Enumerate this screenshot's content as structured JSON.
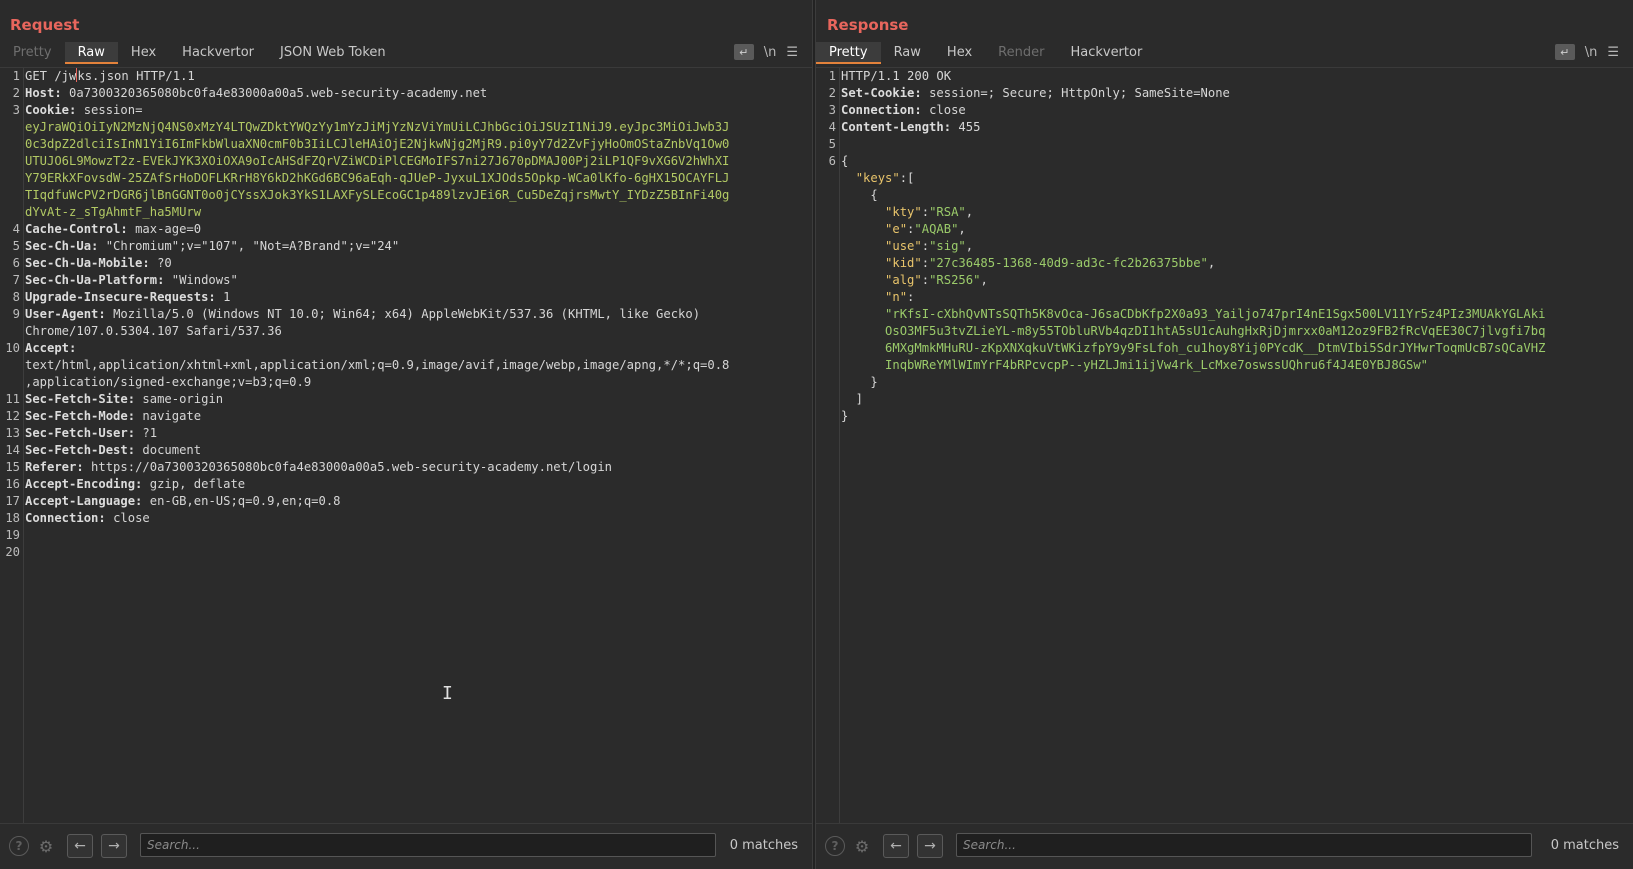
{
  "request": {
    "title": "Request",
    "tabs": [
      {
        "label": "Pretty",
        "state": "disabled"
      },
      {
        "label": "Raw",
        "state": "active"
      },
      {
        "label": "Hex",
        "state": ""
      },
      {
        "label": "Hackvertor",
        "state": ""
      },
      {
        "label": "JSON Web Token",
        "state": ""
      }
    ],
    "newline_toggle": "\\n",
    "lines": [
      {
        "n": "1",
        "parts": [
          {
            "c": "hv",
            "t": "GET /jw"
          },
          {
            "c": "caret",
            "t": ""
          },
          {
            "c": "hv",
            "t": "ks.json HTTP/1.1"
          }
        ]
      },
      {
        "n": "2",
        "parts": [
          {
            "c": "hk",
            "t": "Host: "
          },
          {
            "c": "hv",
            "t": "0a7300320365080bc0fa4e83000a00a5.web-security-academy.net"
          }
        ]
      },
      {
        "n": "3",
        "parts": [
          {
            "c": "hk",
            "t": "Cookie: "
          },
          {
            "c": "hv",
            "t": "session="
          }
        ]
      },
      {
        "n": "",
        "parts": [
          {
            "c": "ck",
            "t": "eyJraWQiOiIyN2MzNjQ4NS0xMzY4LTQwZDktYWQzYy1mYzJiMjYzNzViYmUiLCJhbGciOiJSUzI1NiJ9.eyJpc3MiOiJwb3J"
          }
        ]
      },
      {
        "n": "",
        "parts": [
          {
            "c": "ck",
            "t": "0c3dpZ2dlciIsInN1YiI6ImFkbWluaXN0cmF0b3IiLCJleHAiOjE2NjkwNjg2MjR9.pi0yY7d2ZvFjyHoOmOStaZnbVq1Ow0"
          }
        ]
      },
      {
        "n": "",
        "parts": [
          {
            "c": "ck",
            "t": "UTUJO6L9MowzT2z-EVEkJYK3XOiOXA9oIcAHSdFZQrVZiWCDiPlCEGMoIFS7ni27J670pDMAJ00Pj2iLP1QF9vXG6V2hWhXI"
          }
        ]
      },
      {
        "n": "",
        "parts": [
          {
            "c": "ck",
            "t": "Y79ERkXFovsdW-25ZAfSrHoDOFLKRrH8Y6kD2hKGd6BC96aEqh-qJUeP-JyxuL1XJOds5Opkp-WCa0lKfo-6gHX15OCAYFLJ"
          }
        ]
      },
      {
        "n": "",
        "parts": [
          {
            "c": "ck",
            "t": "TIqdfuWcPV2rDGR6jlBnGGNT0o0jCYssXJok3YkS1LAXFySLEcoGC1p489lzvJEi6R_Cu5DeZqjrsMwtY_IYDzZ5BInFi40g"
          }
        ]
      },
      {
        "n": "",
        "parts": [
          {
            "c": "ck",
            "t": "dYvAt-z_sTgAhmtF_ha5MUrw"
          }
        ]
      },
      {
        "n": "4",
        "parts": [
          {
            "c": "hk",
            "t": "Cache-Control: "
          },
          {
            "c": "hv",
            "t": "max-age=0"
          }
        ]
      },
      {
        "n": "5",
        "parts": [
          {
            "c": "hk",
            "t": "Sec-Ch-Ua: "
          },
          {
            "c": "hv",
            "t": "\"Chromium\";v=\"107\", \"Not=A?Brand\";v=\"24\""
          }
        ]
      },
      {
        "n": "6",
        "parts": [
          {
            "c": "hk",
            "t": "Sec-Ch-Ua-Mobile: "
          },
          {
            "c": "hv",
            "t": "?0"
          }
        ]
      },
      {
        "n": "7",
        "parts": [
          {
            "c": "hk",
            "t": "Sec-Ch-Ua-Platform: "
          },
          {
            "c": "hv",
            "t": "\"Windows\""
          }
        ]
      },
      {
        "n": "8",
        "parts": [
          {
            "c": "hk",
            "t": "Upgrade-Insecure-Requests: "
          },
          {
            "c": "hv",
            "t": "1"
          }
        ]
      },
      {
        "n": "9",
        "parts": [
          {
            "c": "hk",
            "t": "User-Agent: "
          },
          {
            "c": "hv",
            "t": "Mozilla/5.0 (Windows NT 10.0; Win64; x64) AppleWebKit/537.36 (KHTML, like Gecko)"
          }
        ]
      },
      {
        "n": "",
        "parts": [
          {
            "c": "hv",
            "t": "Chrome/107.0.5304.107 Safari/537.36"
          }
        ]
      },
      {
        "n": "10",
        "parts": [
          {
            "c": "hk",
            "t": "Accept: "
          }
        ]
      },
      {
        "n": "",
        "parts": [
          {
            "c": "hv",
            "t": "text/html,application/xhtml+xml,application/xml;q=0.9,image/avif,image/webp,image/apng,*/*;q=0.8"
          }
        ]
      },
      {
        "n": "",
        "parts": [
          {
            "c": "hv",
            "t": ",application/signed-exchange;v=b3;q=0.9"
          }
        ]
      },
      {
        "n": "11",
        "parts": [
          {
            "c": "hk",
            "t": "Sec-Fetch-Site: "
          },
          {
            "c": "hv",
            "t": "same-origin"
          }
        ]
      },
      {
        "n": "12",
        "parts": [
          {
            "c": "hk",
            "t": "Sec-Fetch-Mode: "
          },
          {
            "c": "hv",
            "t": "navigate"
          }
        ]
      },
      {
        "n": "13",
        "parts": [
          {
            "c": "hk",
            "t": "Sec-Fetch-User: "
          },
          {
            "c": "hv",
            "t": "?1"
          }
        ]
      },
      {
        "n": "14",
        "parts": [
          {
            "c": "hk",
            "t": "Sec-Fetch-Dest: "
          },
          {
            "c": "hv",
            "t": "document"
          }
        ]
      },
      {
        "n": "15",
        "parts": [
          {
            "c": "hk",
            "t": "Referer: "
          },
          {
            "c": "hv",
            "t": "https://0a7300320365080bc0fa4e83000a00a5.web-security-academy.net/login"
          }
        ]
      },
      {
        "n": "16",
        "parts": [
          {
            "c": "hk",
            "t": "Accept-Encoding: "
          },
          {
            "c": "hv",
            "t": "gzip, deflate"
          }
        ]
      },
      {
        "n": "17",
        "parts": [
          {
            "c": "hk",
            "t": "Accept-Language: "
          },
          {
            "c": "hv",
            "t": "en-GB,en-US;q=0.9,en;q=0.8"
          }
        ]
      },
      {
        "n": "18",
        "parts": [
          {
            "c": "hk",
            "t": "Connection: "
          },
          {
            "c": "hv",
            "t": "close"
          }
        ]
      },
      {
        "n": "19",
        "parts": []
      },
      {
        "n": "20",
        "parts": []
      }
    ],
    "search_placeholder": "Search...",
    "matches": "0 matches"
  },
  "response": {
    "title": "Response",
    "tabs": [
      {
        "label": "Pretty",
        "state": "active"
      },
      {
        "label": "Raw",
        "state": ""
      },
      {
        "label": "Hex",
        "state": ""
      },
      {
        "label": "Render",
        "state": "disabled"
      },
      {
        "label": "Hackvertor",
        "state": ""
      }
    ],
    "newline_toggle": "\\n",
    "lines": [
      {
        "n": "1",
        "parts": [
          {
            "c": "hv",
            "t": "HTTP/1.1 200 OK"
          }
        ]
      },
      {
        "n": "2",
        "parts": [
          {
            "c": "hk",
            "t": "Set-Cookie: "
          },
          {
            "c": "hv",
            "t": "session=; Secure; HttpOnly; SameSite=None"
          }
        ]
      },
      {
        "n": "3",
        "parts": [
          {
            "c": "hk",
            "t": "Connection: "
          },
          {
            "c": "hv",
            "t": "close"
          }
        ]
      },
      {
        "n": "4",
        "parts": [
          {
            "c": "hk",
            "t": "Content-Length: "
          },
          {
            "c": "hv",
            "t": "455"
          }
        ]
      },
      {
        "n": "5",
        "parts": []
      },
      {
        "n": "6",
        "parts": [
          {
            "c": "jp",
            "t": "{"
          }
        ]
      },
      {
        "n": "",
        "parts": [
          {
            "c": "jp",
            "t": "  "
          },
          {
            "c": "jkey",
            "t": "\"keys\""
          },
          {
            "c": "jp",
            "t": ":["
          }
        ]
      },
      {
        "n": "",
        "parts": [
          {
            "c": "jp",
            "t": "    {"
          }
        ]
      },
      {
        "n": "",
        "parts": [
          {
            "c": "jp",
            "t": "      "
          },
          {
            "c": "jkey",
            "t": "\"kty\""
          },
          {
            "c": "jp",
            "t": ":"
          },
          {
            "c": "jstr",
            "t": "\"RSA\""
          },
          {
            "c": "jp",
            "t": ","
          }
        ]
      },
      {
        "n": "",
        "parts": [
          {
            "c": "jp",
            "t": "      "
          },
          {
            "c": "jkey",
            "t": "\"e\""
          },
          {
            "c": "jp",
            "t": ":"
          },
          {
            "c": "jstr",
            "t": "\"AQAB\""
          },
          {
            "c": "jp",
            "t": ","
          }
        ]
      },
      {
        "n": "",
        "parts": [
          {
            "c": "jp",
            "t": "      "
          },
          {
            "c": "jkey",
            "t": "\"use\""
          },
          {
            "c": "jp",
            "t": ":"
          },
          {
            "c": "jstr",
            "t": "\"sig\""
          },
          {
            "c": "jp",
            "t": ","
          }
        ]
      },
      {
        "n": "",
        "parts": [
          {
            "c": "jp",
            "t": "      "
          },
          {
            "c": "jkey",
            "t": "\"kid\""
          },
          {
            "c": "jp",
            "t": ":"
          },
          {
            "c": "jstr",
            "t": "\"27c36485-1368-40d9-ad3c-fc2b26375bbe\""
          },
          {
            "c": "jp",
            "t": ","
          }
        ]
      },
      {
        "n": "",
        "parts": [
          {
            "c": "jp",
            "t": "      "
          },
          {
            "c": "jkey",
            "t": "\"alg\""
          },
          {
            "c": "jp",
            "t": ":"
          },
          {
            "c": "jstr",
            "t": "\"RS256\""
          },
          {
            "c": "jp",
            "t": ","
          }
        ]
      },
      {
        "n": "",
        "parts": [
          {
            "c": "jp",
            "t": "      "
          },
          {
            "c": "jkey",
            "t": "\"n\""
          },
          {
            "c": "jp",
            "t": ":"
          }
        ]
      },
      {
        "n": "",
        "parts": [
          {
            "c": "jp",
            "t": "      "
          },
          {
            "c": "jstr",
            "t": "\"rKfsI-cXbhQvNTsSQTh5K8vOca-J6saCDbKfp2X0a93_Yailjo747prI4nE1Sgx500LV11Yr5z4PIz3MUAkYGLAki"
          }
        ]
      },
      {
        "n": "",
        "parts": [
          {
            "c": "jp",
            "t": "      "
          },
          {
            "c": "jstr",
            "t": "OsO3MF5u3tvZLieYL-m8y55TObluRVb4qzDI1htA5sU1cAuhgHxRjDjmrxx0aM12oz9FB2fRcVqEE30C7jlvgfi7bq"
          }
        ]
      },
      {
        "n": "",
        "parts": [
          {
            "c": "jp",
            "t": "      "
          },
          {
            "c": "jstr",
            "t": "6MXgMmkMHuRU-zKpXNXqkuVtWKizfpY9y9FsLfoh_cu1hoy8Yij0PYcdK__DtmVIbi5SdrJYHwrToqmUcB7sQCaVHZ"
          }
        ]
      },
      {
        "n": "",
        "parts": [
          {
            "c": "jp",
            "t": "      "
          },
          {
            "c": "jstr",
            "t": "InqbWReYMlWImYrF4bRPcvcpP--yHZLJmi1ijVw4rk_LcMxe7oswssUQhru6f4J4E0YBJ8GSw\""
          }
        ]
      },
      {
        "n": "",
        "parts": [
          {
            "c": "jp",
            "t": "    }"
          }
        ]
      },
      {
        "n": "",
        "parts": [
          {
            "c": "jp",
            "t": "  ]"
          }
        ]
      },
      {
        "n": "",
        "parts": [
          {
            "c": "jp",
            "t": "}"
          }
        ]
      }
    ],
    "search_placeholder": "Search...",
    "matches": "0 matches"
  },
  "icons": {
    "wrap": "wrap-lines-icon",
    "menu": "menu-icon",
    "help": "help-icon",
    "settings": "gear-icon",
    "back": "arrow-left-icon",
    "forward": "arrow-right-icon"
  },
  "colors": {
    "title": "#e8665d",
    "active_tab_underline": "#e3823b",
    "cookie_value": "#b2c964",
    "json_key": "#e8c46b",
    "json_string": "#9bcb6a"
  }
}
